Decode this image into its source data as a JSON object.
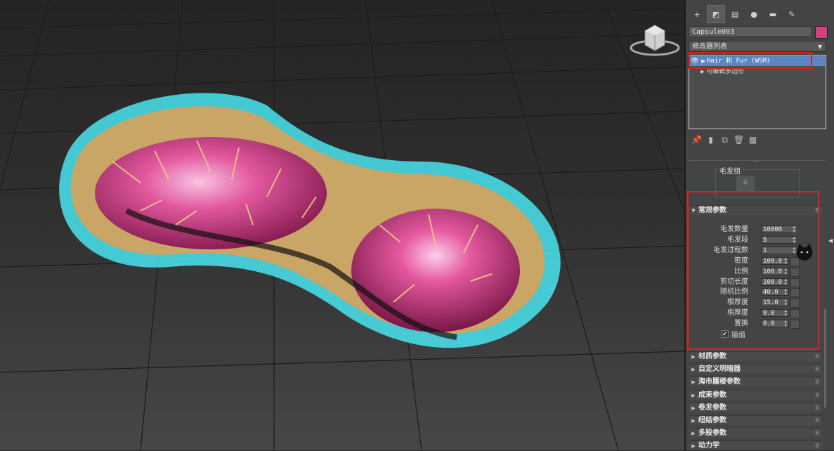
{
  "panel": {
    "tabs": [
      {
        "icon": "create-plus-icon",
        "glyph": "+"
      },
      {
        "icon": "modify-icon",
        "glyph": "◩"
      },
      {
        "icon": "hierarchy-icon",
        "glyph": "▤"
      },
      {
        "icon": "motion-icon",
        "glyph": "●"
      },
      {
        "icon": "display-icon",
        "glyph": "▬"
      },
      {
        "icon": "utilities-wrench-icon",
        "glyph": "✎"
      }
    ],
    "object_name": "Capsule003",
    "object_color": "#d63d82",
    "modifier_list_label": "修改器列表",
    "stack": [
      {
        "label": "Hair 和 Fur (WSM)",
        "selected": true
      },
      {
        "label": "可编辑多边形",
        "selected": false
      }
    ],
    "group_title": "毛发组",
    "general_rollout_title": "常规参数",
    "params": [
      {
        "label": "毛发数量",
        "value": "10000",
        "has_map": false
      },
      {
        "label": "毛发段",
        "value": "5",
        "has_map": false
      },
      {
        "label": "毛发过程数",
        "value": "1",
        "has_map": false
      },
      {
        "label": "密度",
        "value": "100.0",
        "has_map": true
      },
      {
        "label": "比例",
        "value": "100.0",
        "has_map": true
      },
      {
        "label": "剪切长度",
        "value": "100.0",
        "has_map": true
      },
      {
        "label": "随机比例",
        "value": "40.0",
        "has_map": true
      },
      {
        "label": "根厚度",
        "value": "15.0",
        "has_map": true
      },
      {
        "label": "梢厚度",
        "value": "0.0",
        "has_map": true
      },
      {
        "label": "置换",
        "value": "0.0",
        "has_map": true
      }
    ],
    "interpolate_label": "插值",
    "interpolate_checked": true,
    "collapsed_rollouts": [
      "材质参数",
      "自定义明暗器",
      "海市蜃楼参数",
      "成束参数",
      "卷发参数",
      "纽结参数",
      "多股参数",
      "动力学"
    ],
    "highlight_color": "#e01f1f"
  },
  "viewport": {
    "viewcube_label": "顶"
  }
}
